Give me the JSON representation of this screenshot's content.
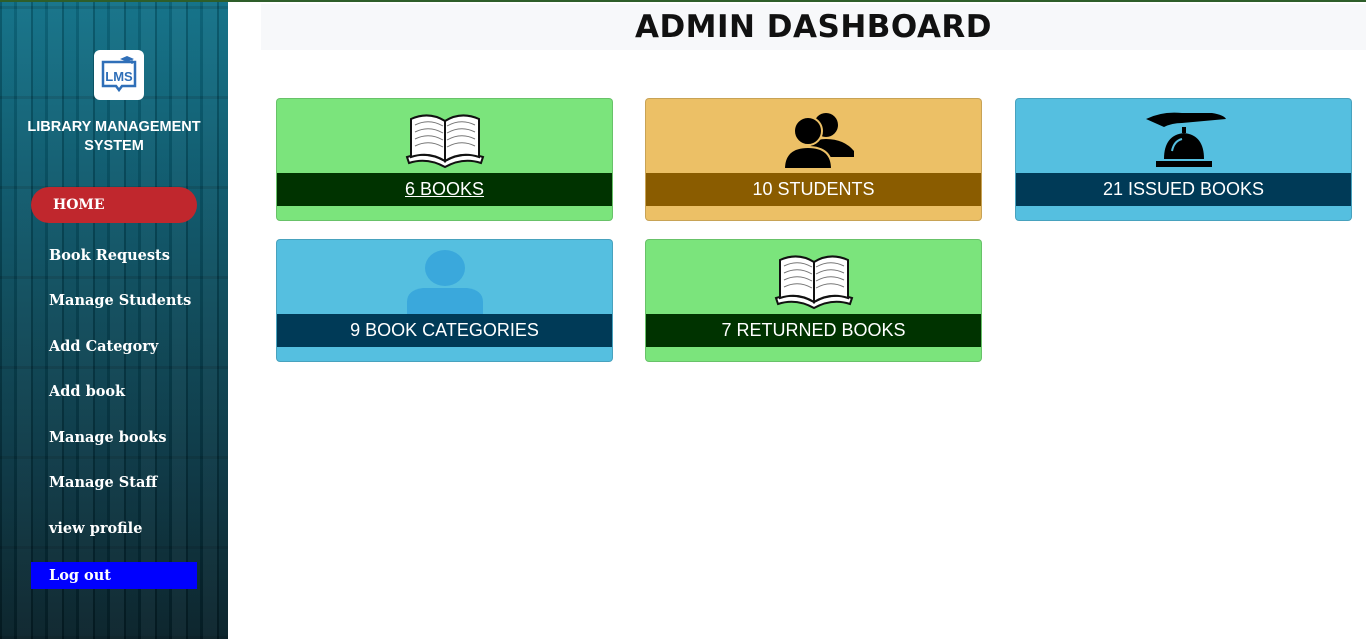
{
  "app": {
    "logo_text": "LMS",
    "title": "LIBRARY MANAGEMENT SYSTEM"
  },
  "sidebar": {
    "home_label": "HOME",
    "items": [
      {
        "label": "Book Requests"
      },
      {
        "label": "Manage Students"
      },
      {
        "label": "Add Category"
      },
      {
        "label": "Add book"
      },
      {
        "label": "Manage books"
      },
      {
        "label": "Manage Staff"
      },
      {
        "label": "view profile"
      }
    ],
    "logout_label": "Log out"
  },
  "header": {
    "title": "ADMIN DASHBOARD"
  },
  "cards": [
    {
      "label": "6 BOOKS",
      "icon": "open-book-icon",
      "color": "#7be47c"
    },
    {
      "label": "10 STUDENTS",
      "icon": "users-icon",
      "color": "#ecc066"
    },
    {
      "label": "21 ISSUED BOOKS",
      "icon": "service-bell-icon",
      "color": "#55bfe0"
    },
    {
      "label": "9 BOOK CATEGORIES",
      "icon": "user-icon",
      "color": "#55bfe0"
    },
    {
      "label": "7 RETURNED BOOKS",
      "icon": "open-book-icon",
      "color": "#7be47c"
    }
  ],
  "colors": {
    "home_button": "#c0272d",
    "logout_button": "#0000ff",
    "green_bar": "#003300",
    "orange_bar": "#8a5c00",
    "blue_bar": "#003a57"
  }
}
